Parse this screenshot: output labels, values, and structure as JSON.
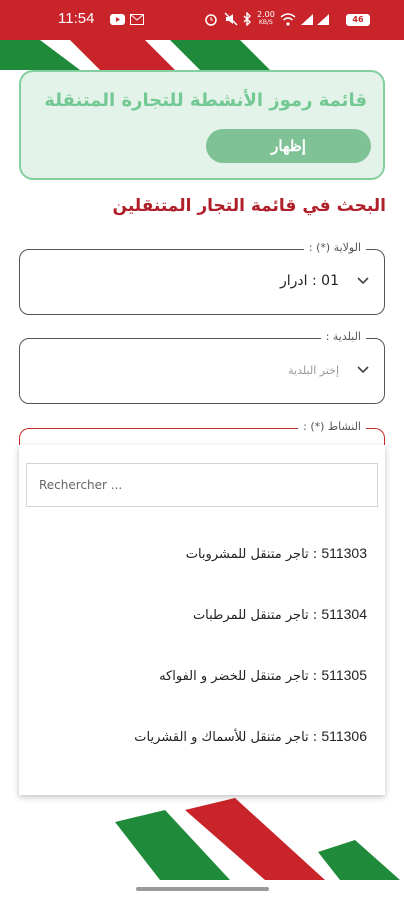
{
  "status_bar": {
    "time": "11:54",
    "data_speed": "2.00",
    "data_speed_unit": "KB/S",
    "battery_level": "46",
    "bg_color": "#c8242a"
  },
  "card": {
    "title": "قائمة رموز الأنشطة للتجارة المتنقلة",
    "show_button": "إظهار"
  },
  "search_heading": "البحث في قائمة التجار المتنقلين",
  "wilaya": {
    "label": "الولاية (*) :",
    "value": "01 : ادرار"
  },
  "commune": {
    "label": "البلدية :",
    "placeholder": "إختر البلدية"
  },
  "activity": {
    "label": "النشاط (*) :"
  },
  "dropdown": {
    "search_placeholder": "Rechercher ...",
    "options": [
      {
        "code": "511303",
        "label": "تاجر متنقل للمشروبات"
      },
      {
        "code": "511304",
        "label": "تاجر متنقل للمرطبات"
      },
      {
        "code": "511305",
        "label": "تاجر متنقل للخضر و الفواكه"
      },
      {
        "code": "511306",
        "label": "تاجر متنقل للأسماك و القشريات"
      }
    ]
  },
  "colors": {
    "brand_red": "#c8242a",
    "brand_green": "#1f8a3a",
    "card_green": "#84cf9f"
  }
}
